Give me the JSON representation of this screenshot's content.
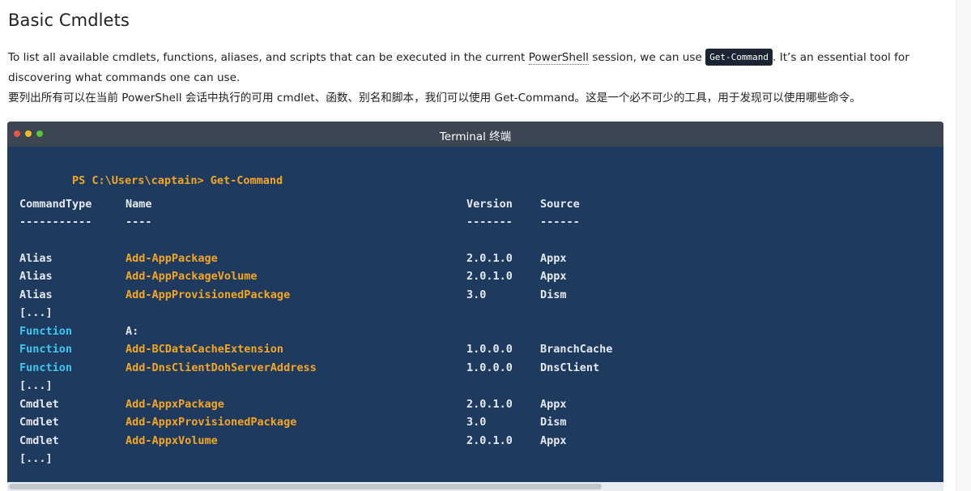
{
  "heading": "Basic Cmdlets",
  "paragraph": {
    "en_before": "To list all available cmdlets, functions, aliases, and scripts that can be executed in the current ",
    "en_powershell": "PowerShell",
    "en_middle": " session, we can use ",
    "en_code": "Get-Command",
    "en_after": ". It’s an essential tool for discovering what commands one can use.",
    "zh": "要列出所有可以在当前 PowerShell 会话中执行的可用 cmdlet、函数、别名和脚本，我们可以使用 Get-Command。这是一个必不可少的工具，用于发现可以使用哪些命令。"
  },
  "terminal": {
    "title": "Terminal  终端",
    "prompt": "PS C:\\Users\\captain> ",
    "command": "Get-Command",
    "headers": {
      "type": "CommandType",
      "name": "Name",
      "version": "Version",
      "source": "Source"
    },
    "separators": {
      "type": "-----------",
      "name": "----",
      "version": "-------",
      "source": "------"
    },
    "ellipsis": "[...]",
    "alias_rows": [
      {
        "type": "Alias",
        "name": "Add-AppPackage",
        "version": "2.0.1.0",
        "source": "Appx"
      },
      {
        "type": "Alias",
        "name": "Add-AppPackageVolume",
        "version": "2.0.1.0",
        "source": "Appx"
      },
      {
        "type": "Alias",
        "name": "Add-AppProvisionedPackage",
        "version": "3.0",
        "source": "Dism"
      }
    ],
    "function_rows": [
      {
        "type": "Function",
        "name": "A:",
        "version": "",
        "source": ""
      },
      {
        "type": "Function",
        "name": "Add-BCDataCacheExtension",
        "version": "1.0.0.0",
        "source": "BranchCache"
      },
      {
        "type": "Function",
        "name": "Add-DnsClientDohServerAddress",
        "version": "1.0.0.0",
        "source": "DnsClient"
      }
    ],
    "cmdlet_rows": [
      {
        "type": "Cmdlet",
        "name": "Add-AppxPackage",
        "version": "2.0.1.0",
        "source": "Appx"
      },
      {
        "type": "Cmdlet",
        "name": "Add-AppxProvisionedPackage",
        "version": "3.0",
        "source": "Dism"
      },
      {
        "type": "Cmdlet",
        "name": "Add-AppxVolume",
        "version": "2.0.1.0",
        "source": "Appx"
      }
    ]
  },
  "colors": {
    "terminal_bg": "#1f3a5f",
    "titlebar_bg": "#3c4552",
    "accent_orange": "#f5a623",
    "accent_cyan": "#3bc8f0",
    "code_bg": "#1b2433"
  }
}
